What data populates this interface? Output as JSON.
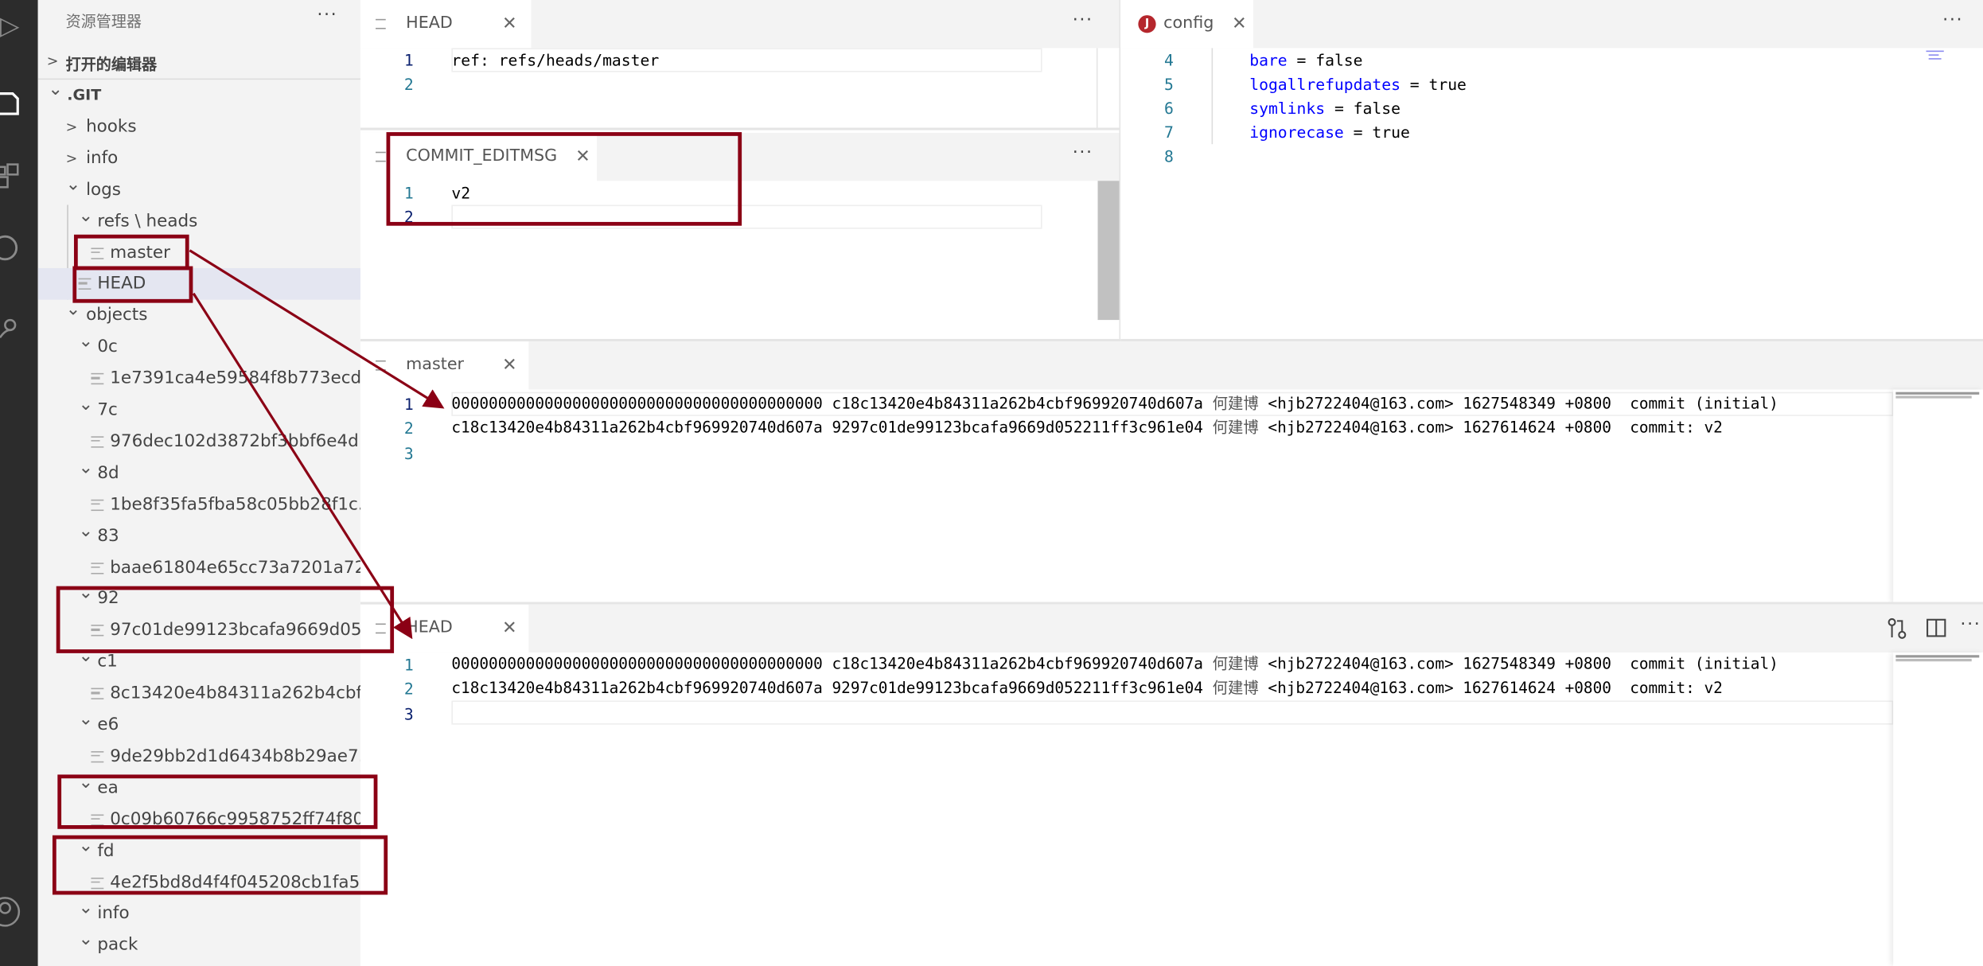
{
  "activity_bar": {
    "icons": [
      "run-debug-icon",
      "explorer-icon",
      "extensions-icon",
      "search-icon",
      "source-control-icon",
      "account-icon"
    ]
  },
  "sidebar": {
    "title": "资源管理器",
    "more": "···",
    "open_editors": "打开的编辑器",
    "tree": [
      {
        "label": ".GIT",
        "type": "folder",
        "expanded": true,
        "level": 0
      },
      {
        "label": "hooks",
        "type": "folder",
        "expanded": false,
        "level": 1
      },
      {
        "label": "info",
        "type": "folder",
        "expanded": false,
        "level": 1
      },
      {
        "label": "logs",
        "type": "folder",
        "expanded": true,
        "level": 1
      },
      {
        "label": "refs \\ heads",
        "type": "folder",
        "expanded": true,
        "level": 2
      },
      {
        "label": "master",
        "type": "file",
        "level": 3
      },
      {
        "label": "HEAD",
        "type": "file",
        "level": 2,
        "selected": true
      },
      {
        "label": "objects",
        "type": "folder",
        "expanded": true,
        "level": 1
      },
      {
        "label": "0c",
        "type": "folder",
        "expanded": true,
        "level": 2
      },
      {
        "label": "1e7391ca4e59584f8b773ecd...",
        "type": "file",
        "level": 3
      },
      {
        "label": "7c",
        "type": "folder",
        "expanded": true,
        "level": 2
      },
      {
        "label": "976dec102d3872bf3bbf6e4d...",
        "type": "file",
        "level": 3
      },
      {
        "label": "8d",
        "type": "folder",
        "expanded": true,
        "level": 2
      },
      {
        "label": "1be8f35fa5fba58c05bb28f1c...",
        "type": "file",
        "level": 3
      },
      {
        "label": "83",
        "type": "folder",
        "expanded": true,
        "level": 2
      },
      {
        "label": "baae61804e65cc73a7201a72...",
        "type": "file",
        "level": 3
      },
      {
        "label": "92",
        "type": "folder",
        "expanded": true,
        "level": 2
      },
      {
        "label": "97c01de99123bcafa9669d05...",
        "type": "file",
        "level": 3
      },
      {
        "label": "c1",
        "type": "folder",
        "expanded": true,
        "level": 2
      },
      {
        "label": "8c13420e4b84311a262b4cbf...",
        "type": "file",
        "level": 3
      },
      {
        "label": "e6",
        "type": "folder",
        "expanded": true,
        "level": 2
      },
      {
        "label": "9de29bb2d1d6434b8b29ae7...",
        "type": "file",
        "level": 3
      },
      {
        "label": "ea",
        "type": "folder",
        "expanded": true,
        "level": 2
      },
      {
        "label": "0c09b60766c9958752ff74f80...",
        "type": "file",
        "level": 3
      },
      {
        "label": "fd",
        "type": "folder",
        "expanded": true,
        "level": 2
      },
      {
        "label": "4e2f5bd8d4f4f045208cb1fa5...",
        "type": "file",
        "level": 3
      },
      {
        "label": "info",
        "type": "folder",
        "expanded": true,
        "level": 2
      },
      {
        "label": "pack",
        "type": "folder",
        "expanded": true,
        "level": 2
      }
    ]
  },
  "editors": {
    "head_top": {
      "tab": "HEAD",
      "close": "✕",
      "more": "···",
      "lines": [
        {
          "n": "1",
          "text": "ref: refs/heads/master"
        },
        {
          "n": "2",
          "text": ""
        }
      ]
    },
    "commit_editmsg": {
      "tab": "COMMIT_EDITMSG",
      "close": "✕",
      "more": "···",
      "lines": [
        {
          "n": "1",
          "text": "v2"
        },
        {
          "n": "2",
          "text": ""
        }
      ]
    },
    "config": {
      "tab": "config",
      "tab_icon_letter": "J",
      "close": "✕",
      "more": "···",
      "lines": [
        {
          "n": "4",
          "key": "bare",
          "value": " = false"
        },
        {
          "n": "5",
          "key": "logallrefupdates",
          "value": " = true"
        },
        {
          "n": "6",
          "key": "symlinks",
          "value": " = false"
        },
        {
          "n": "7",
          "key": "ignorecase",
          "value": " = true"
        },
        {
          "n": "8",
          "key": "",
          "value": ""
        }
      ]
    },
    "master": {
      "tab": "master",
      "close": "✕",
      "lines": [
        {
          "n": "1",
          "a": "0000000000000000000000000000000000000000 c18c13420e4b84311a262b4cbf969920740d607a ",
          "name": "何建博",
          "b": " <hjb2722404@163.com> 1627548349 +0800  commit (initial)"
        },
        {
          "n": "2",
          "a": "c18c13420e4b84311a262b4cbf969920740d607a 9297c01de99123bcafa9669d052211ff3c961e04 ",
          "name": "何建博",
          "b": " <hjb2722404@163.com> 1627614624 +0800  commit: v2"
        },
        {
          "n": "3",
          "a": "",
          "name": "",
          "b": ""
        }
      ]
    },
    "head_bottom": {
      "tab": "HEAD",
      "close": "✕",
      "more": "···",
      "actions": [
        "open-changes-icon",
        "split-editor-icon"
      ],
      "lines": [
        {
          "n": "1",
          "a": "0000000000000000000000000000000000000000 c18c13420e4b84311a262b4cbf969920740d607a ",
          "name": "何建博",
          "b": " <hjb2722404@163.com> 1627548349 +0800  commit (initial)"
        },
        {
          "n": "2",
          "a": "c18c13420e4b84311a262b4cbf969920740d607a 9297c01de99123bcafa9669d052211ff3c961e04 ",
          "name": "何建博",
          "b": " <hjb2722404@163.com> 1627614624 +0800  commit: v2"
        },
        {
          "n": "3",
          "a": "",
          "name": "",
          "b": ""
        }
      ]
    }
  },
  "colors": {
    "annotation": "#8b0015",
    "activity_bar": "#2c2c2c",
    "sidebar": "#f3f3f3",
    "selected_row": "#e4e6f1",
    "line_number": "#237893",
    "keyword": "#0000ff"
  }
}
